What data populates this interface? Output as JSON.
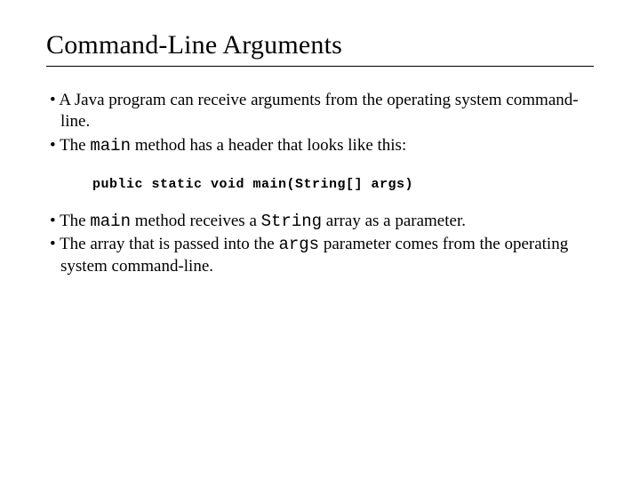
{
  "title": "Command-Line Arguments",
  "bullets_a": {
    "b1": "A Java program can receive arguments from the operating system command-line.",
    "b2_pre": "The ",
    "b2_mono": "main",
    "b2_post": " method has a header that looks like this:"
  },
  "code": "public static void main(String[] args)",
  "bullets_b": {
    "b3_pre": "The ",
    "b3_mono1": "main",
    "b3_mid": " method receives a ",
    "b3_mono2": "String",
    "b3_post": " array as a parameter.",
    "b4_pre": "The array that is passed into the ",
    "b4_mono": "args",
    "b4_post": " parameter comes from the operating system command-line."
  }
}
